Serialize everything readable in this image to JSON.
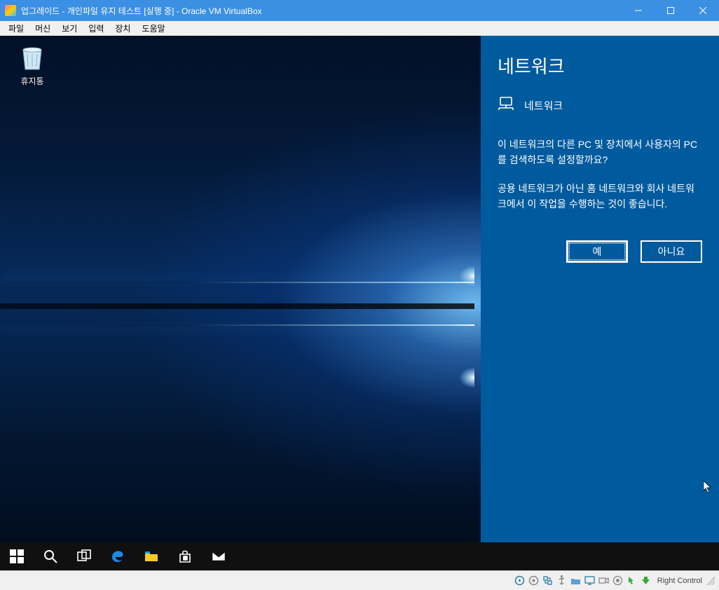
{
  "window": {
    "title": "업그레이드 - 개인파일 유지 테스트 [실행 중] - Oracle VM VirtualBox"
  },
  "menu": {
    "file": "파일",
    "machine": "머신",
    "view": "보기",
    "input": "입력",
    "devices": "장치",
    "help": "도움말"
  },
  "desktop": {
    "recycle_bin": "휴지통"
  },
  "network_panel": {
    "heading": "네트워크",
    "subheading": "네트워크",
    "paragraph1": "이 네트워크의 다른 PC 및 장치에서 사용자의 PC를 검색하도록 설정할까요?",
    "paragraph2": "공용 네트워크가 아닌 홈 네트워크와 회사 네트워크에서 이 작업을 수행하는 것이 좋습니다.",
    "yes": "예",
    "no": "아니요"
  },
  "statusbar": {
    "host_key": "Right Control"
  }
}
